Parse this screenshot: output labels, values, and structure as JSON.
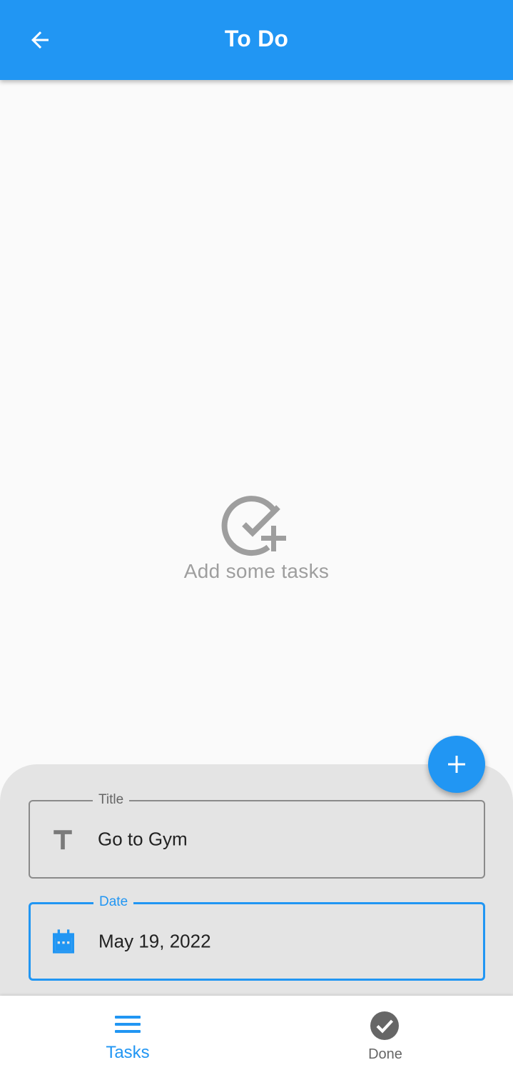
{
  "app_bar": {
    "title": "To Do",
    "background_color": "#2196f3",
    "back_icon": "arrow-back-icon"
  },
  "empty_state": {
    "icon": "check-circle-add-icon",
    "text": "Add some tasks"
  },
  "fab": {
    "icon": "plus-icon"
  },
  "form": {
    "title_field": {
      "label": "Title",
      "value": "Go to Gym",
      "icon": "text-t-icon"
    },
    "date_field": {
      "label": "Date",
      "value": "May 19, 2022",
      "icon": "calendar-icon",
      "focused": true
    }
  },
  "bottom_nav": {
    "items": [
      {
        "label": "Tasks",
        "icon": "menu-list-icon",
        "active": true
      },
      {
        "label": "Done",
        "icon": "check-circle-icon",
        "active": false
      }
    ]
  },
  "colors": {
    "accent": "#2196f3",
    "muted": "#9e9e9e",
    "sheet": "#e4e4e4"
  }
}
